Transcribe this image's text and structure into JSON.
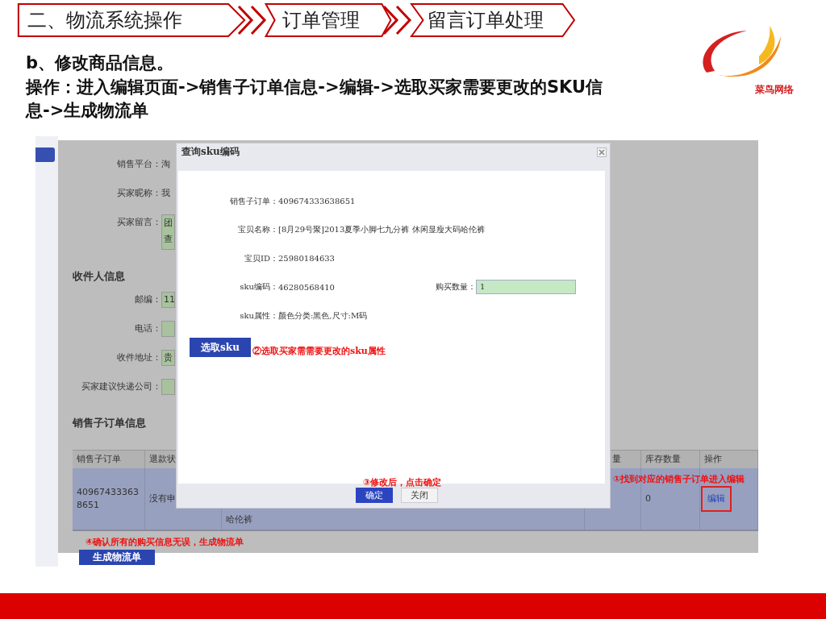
{
  "breadcrumb": [
    {
      "label": "二、物流系统操作"
    },
    {
      "label": "订单管理"
    },
    {
      "label": "留言订单处理"
    }
  ],
  "heading": "b、修改商品信息。",
  "instruction": "操作：进入编辑页面->销售子订单信息->编辑->选取买家需要更改的SKU信息->生成物流单",
  "logo": {
    "text": "菜鸟网络"
  },
  "screen": {
    "order_form": [
      {
        "label": "销售平台：",
        "value": "淘",
        "kind": "text"
      },
      {
        "label": "买家昵称：",
        "value": "我",
        "kind": "text"
      },
      {
        "label": "买家留言：",
        "lines": [
          "团",
          "查"
        ],
        "kind": "field"
      }
    ],
    "recipient": {
      "title": "收件人信息",
      "rows": [
        {
          "label": "邮编：",
          "value": "11",
          "kind": "field"
        },
        {
          "label": "电话：",
          "kind": "field"
        },
        {
          "label": "收件地址：",
          "value": "贵",
          "kind": "field"
        },
        {
          "label": "买家建议快递公司：",
          "kind": "field"
        }
      ]
    },
    "suborders": {
      "title": "销售子订单信息",
      "columns": [
        {
          "label": "销售子订单"
        },
        {
          "label": "退款状"
        },
        {
          "label": "量"
        },
        {
          "label": "库存数量"
        },
        {
          "label": "操作"
        }
      ],
      "rows": [
        {
          "order": "409674333638651",
          "refund": "没有申",
          "item": "哈伦裤",
          "stock": "0",
          "action": "编辑"
        }
      ]
    },
    "generate_button": "生成物流单",
    "dialog": {
      "title": "查询sku编码",
      "rows": [
        {
          "label": "销售子订单：",
          "value": "409674333638651"
        },
        {
          "label": "宝贝名称：",
          "value": "[8月29号聚]2013夏季小脚七九分裤 休闲显瘦大码哈伦裤"
        },
        {
          "label": "宝贝ID：",
          "value": "25980184633"
        },
        {
          "label": "sku编码：",
          "value": "46280568410",
          "extra_label": "购买数量：",
          "extra_value": "1"
        },
        {
          "label": "sku属性：",
          "value": "颜色分类:黑色,尺寸:M码"
        }
      ],
      "select_button": "选取sku",
      "ok_button": "确定",
      "close_button": "关闭"
    },
    "annotations": [
      {
        "text": "①找到对应的销售子订单进入编辑",
        "kind": "edit"
      },
      {
        "text": "②选取买家需需要更改的sku属性",
        "kind": "select"
      },
      {
        "text": "③修改后，点击确定",
        "kind": "confirm"
      },
      {
        "text": "④确认所有的购买信息无误，生成物流单",
        "kind": "generate"
      }
    ]
  }
}
